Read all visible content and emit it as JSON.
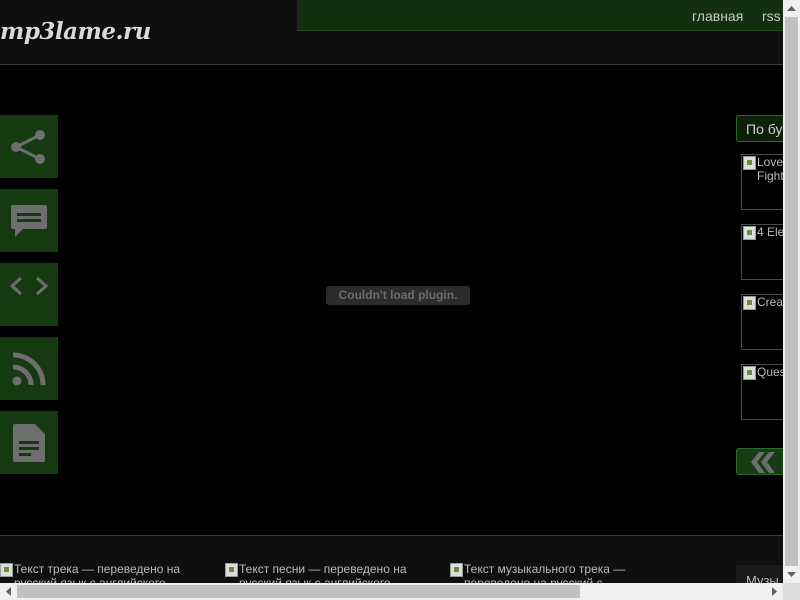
{
  "header": {
    "logo": "mp3lame.ru",
    "nav": [
      {
        "label": "главная"
      },
      {
        "label": "rss"
      }
    ]
  },
  "sidebar": {
    "buttons": [
      {
        "icon": "share-icon"
      },
      {
        "icon": "comment-icon"
      },
      {
        "icon": "code-icon"
      },
      {
        "icon": "rss-icon"
      },
      {
        "icon": "document-icon"
      }
    ]
  },
  "plugin": {
    "message": "Couldn't load plugin."
  },
  "right": {
    "alpha_button": "По бу",
    "thumbs": [
      {
        "alt": "Love Fight"
      },
      {
        "alt": "4 Ele"
      },
      {
        "alt": "Crea"
      },
      {
        "alt": "Ques"
      }
    ]
  },
  "bottom": {
    "items": [
      {
        "alt": "Текст трека — переведено на русский язык с английского"
      },
      {
        "alt": "Текст песни — переведено на русский язык с английского"
      },
      {
        "alt": "Текст музыкального трека — переведено на русский с"
      }
    ],
    "music_tab": "Музы"
  },
  "colors": {
    "background": "#000000",
    "accent_green": "#153a12",
    "nav_green": "#12300f",
    "border_green": "#2d6a27"
  }
}
